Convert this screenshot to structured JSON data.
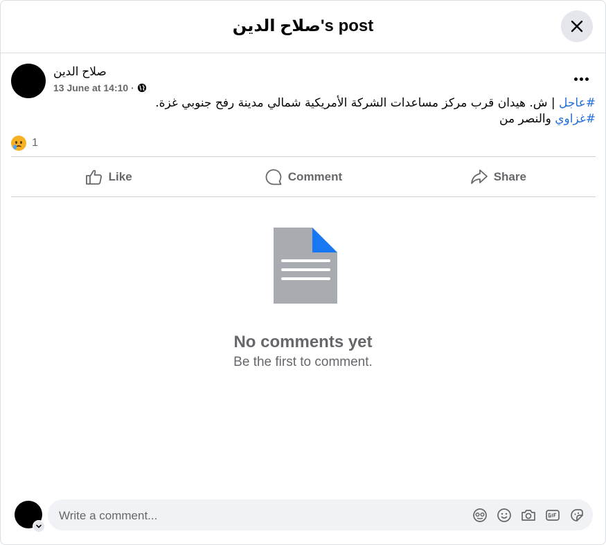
{
  "header": {
    "title": "صلاح الدين's post",
    "close_icon": "close-icon"
  },
  "post": {
    "author": "صلاح الدين",
    "timestamp": "13 June at 14:10",
    "separator": "·",
    "privacy_icon": "globe-icon",
    "options_icon": "more-horizontal-icon",
    "text_line1_hashtag": "#عاجل",
    "text_line1_rest": " | ش. هيدان قرب مركز مساعدات الشركة الأمريكية شمالي مدينة رفح  جنوبي  غزة.",
    "text_line2_hashtag": "#غزاوي",
    "text_line2_rest": " والنصر من",
    "reaction_icon": "sad-reaction-icon",
    "reaction_count": "1"
  },
  "actions": {
    "like": "Like",
    "comment": "Comment",
    "share": "Share"
  },
  "empty_state": {
    "icon": "document-icon",
    "title": "No comments yet",
    "subtitle": "Be the first to comment."
  },
  "composer": {
    "placeholder": "Write a comment...",
    "value": "",
    "icons": [
      "avatar-sticker-icon",
      "emoji-icon",
      "camera-icon",
      "gif-icon",
      "sticker-icon"
    ]
  },
  "colors": {
    "accent": "#216fdb",
    "secondary_text": "#65676b",
    "divider": "#ced0d4",
    "input_bg": "#f0f2f5",
    "doc_fold": "#1877f2",
    "doc_body": "#a8abaf"
  }
}
